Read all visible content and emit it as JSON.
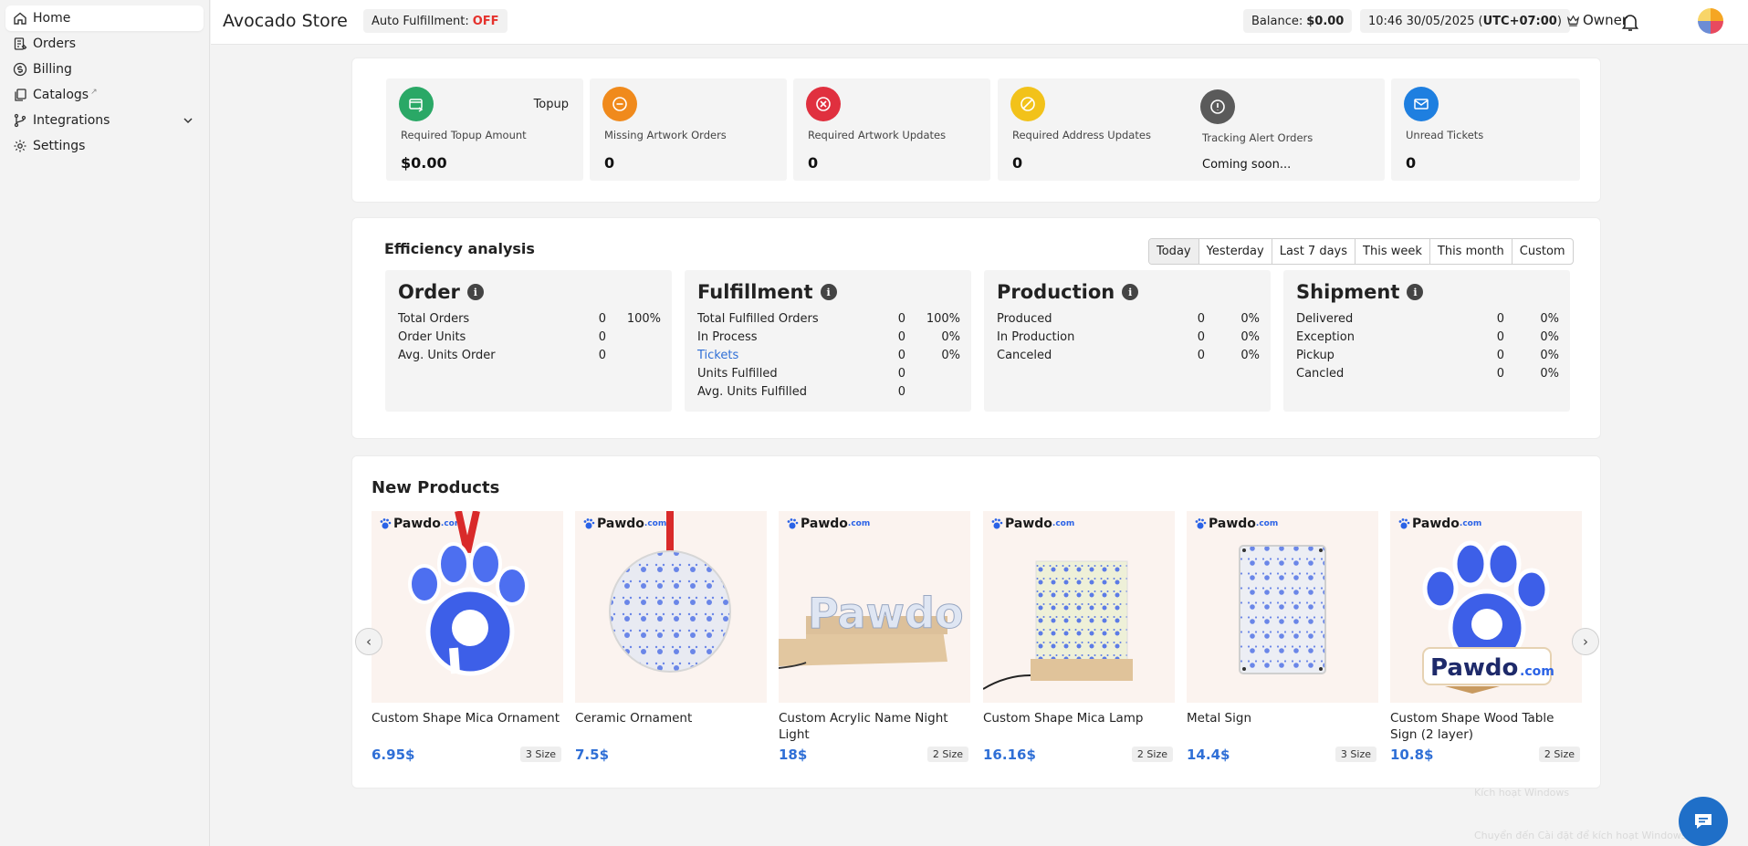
{
  "sidebar": {
    "items": [
      {
        "label": "Home",
        "icon": "home-icon"
      },
      {
        "label": "Orders",
        "icon": "orders-icon"
      },
      {
        "label": "Billing",
        "icon": "dollar-icon"
      },
      {
        "label": "Catalogs",
        "icon": "catalog-icon",
        "ext": "↗"
      },
      {
        "label": "Integrations",
        "icon": "branch-icon"
      },
      {
        "label": "Settings",
        "icon": "gear-icon"
      }
    ]
  },
  "header": {
    "store": "Avocado Store",
    "auto_label": "Auto Fulfillment:",
    "auto_value": "OFF",
    "balance_label": "Balance:",
    "balance_value": "$0.00",
    "datetime": "10:46 30/05/2025",
    "tz_open": "(",
    "tz": "UTC+07:00",
    "tz_close": ")",
    "role": "Owner"
  },
  "stats": [
    {
      "label": "Required Topup Amount",
      "value": "$0.00",
      "extra": "Topup",
      "color": "#2aa866"
    },
    {
      "label": "Missing Artwork Orders",
      "value": "0",
      "color": "#f08a1c"
    },
    {
      "label": "Required Artwork Updates",
      "value": "0",
      "color": "#e0303f"
    },
    {
      "label": "Required Address Updates",
      "value": "0",
      "color": "#f2c21a"
    },
    {
      "label": "Tracking Alert Orders",
      "value": "Coming soon...",
      "color": "#5a5a5a"
    },
    {
      "label": "Unread Tickets",
      "value": "0",
      "color": "#1e7fe0"
    }
  ],
  "efficiency": {
    "title": "Efficiency analysis",
    "ranges": [
      "Today",
      "Yesterday",
      "Last 7 days",
      "This week",
      "This month",
      "Custom"
    ],
    "panels": [
      {
        "title": "Order",
        "rows": [
          {
            "name": "Total Orders",
            "count": "0",
            "pct": "100%"
          },
          {
            "name": "Order Units",
            "count": "0",
            "pct": ""
          },
          {
            "name": "Avg. Units Order",
            "count": "0",
            "pct": ""
          }
        ]
      },
      {
        "title": "Fulfillment",
        "rows": [
          {
            "name": "Total Fulfilled Orders",
            "count": "0",
            "pct": "100%"
          },
          {
            "name": "In Process",
            "count": "0",
            "pct": "0%"
          },
          {
            "name": "Tickets",
            "count": "0",
            "pct": "0%"
          },
          {
            "name": "Units Fulfilled",
            "count": "0",
            "pct": ""
          },
          {
            "name": "Avg. Units Fulfilled",
            "count": "0",
            "pct": ""
          }
        ]
      },
      {
        "title": "Production",
        "rows": [
          {
            "name": "Produced",
            "count": "0",
            "pct": "0%"
          },
          {
            "name": "In Production",
            "count": "0",
            "pct": "0%"
          },
          {
            "name": "Canceled",
            "count": "0",
            "pct": "0%"
          }
        ]
      },
      {
        "title": "Shipment",
        "rows": [
          {
            "name": "Delivered",
            "count": "0",
            "pct": "0%"
          },
          {
            "name": "Exception",
            "count": "0",
            "pct": "0%"
          },
          {
            "name": "Pickup",
            "count": "0",
            "pct": "0%"
          },
          {
            "name": "Cancled",
            "count": "0",
            "pct": "0%"
          }
        ]
      }
    ]
  },
  "products": {
    "title": "New Products",
    "brand": "Pawdo",
    "brand_suffix": ".com",
    "items": [
      {
        "name": "Custom Shape Mica Ornament",
        "price": "6.95$",
        "size": "3 Size"
      },
      {
        "name": "Ceramic Ornament",
        "price": "7.5$",
        "size": ""
      },
      {
        "name": "Custom Acrylic Name Night Light",
        "price": "18$",
        "size": "2 Size"
      },
      {
        "name": "Custom Shape Mica Lamp",
        "price": "16.16$",
        "size": "2 Size"
      },
      {
        "name": "Metal Sign",
        "price": "14.4$",
        "size": "3 Size"
      },
      {
        "name": "Custom Shape Wood Table Sign (2 layer)",
        "price": "10.8$",
        "size": "2 Size"
      }
    ],
    "prev": "‹",
    "next": "›"
  },
  "overlay": {
    "line1": "Kích hoạt Windows",
    "line2": "Chuyển đến Cài đặt để kích hoạt Windows."
  }
}
